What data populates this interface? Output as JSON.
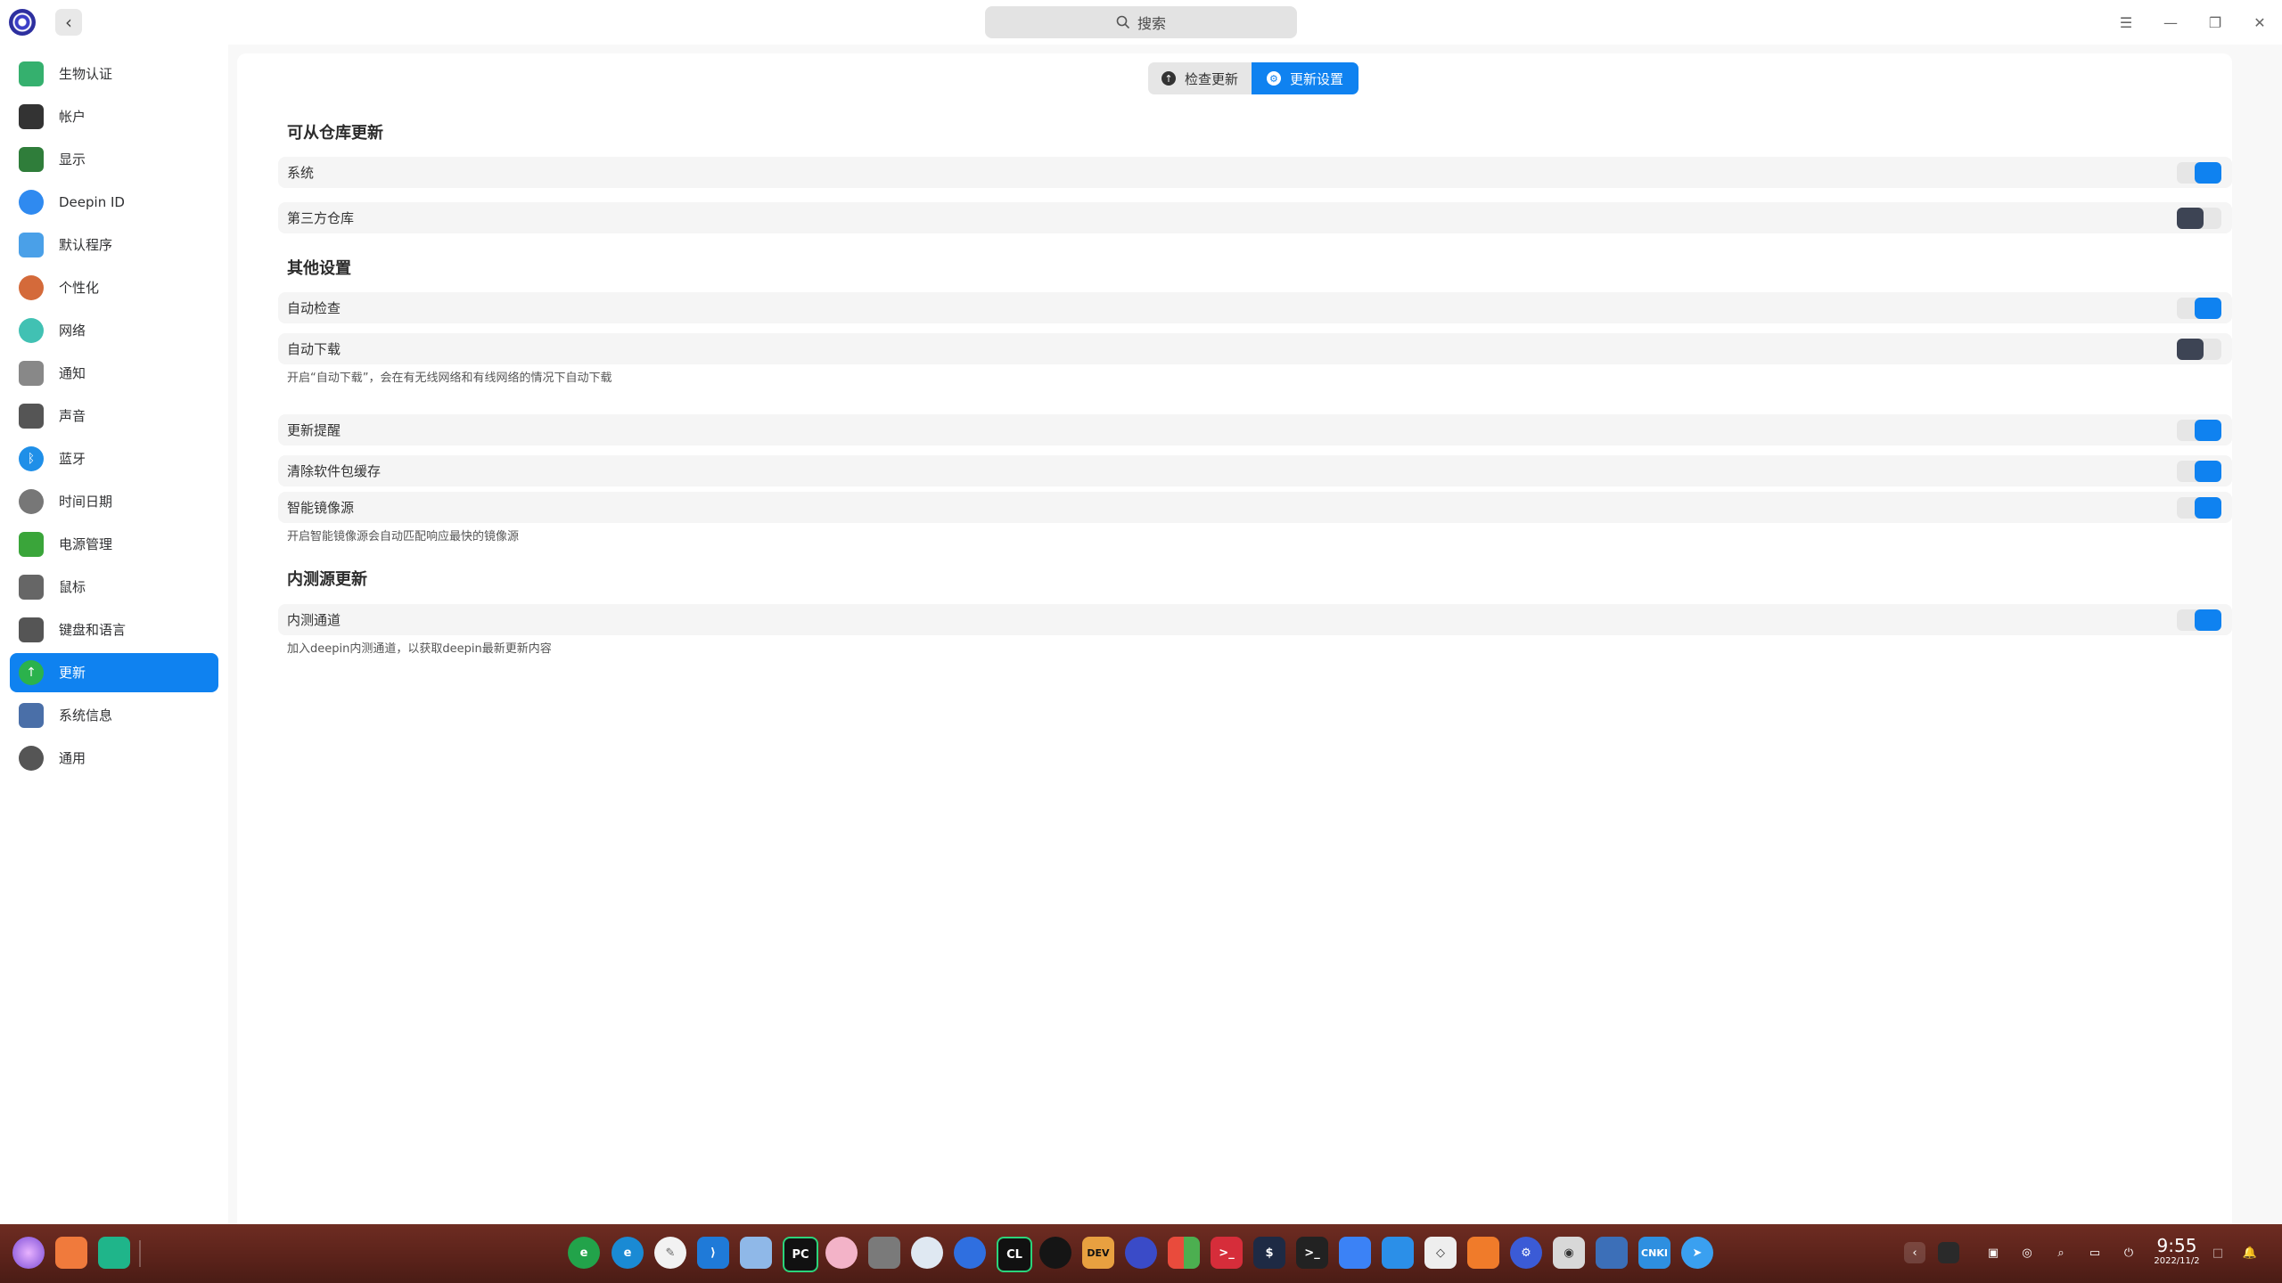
{
  "search": {
    "placeholder": "搜索"
  },
  "window_controls": {
    "menu": "☰",
    "minimize": "—",
    "maximize": "❐",
    "close": "✕"
  },
  "sidebar": {
    "items": [
      {
        "label": "生物认证",
        "icon": "fingerprint-icon",
        "active": false
      },
      {
        "label": "帐户",
        "icon": "account-icon",
        "active": false
      },
      {
        "label": "显示",
        "icon": "display-icon",
        "active": false
      },
      {
        "label": "Deepin ID",
        "icon": "cloud-icon",
        "active": false
      },
      {
        "label": "默认程序",
        "icon": "default-apps-icon",
        "active": false
      },
      {
        "label": "个性化",
        "icon": "personalization-icon",
        "active": false
      },
      {
        "label": "网络",
        "icon": "network-icon",
        "active": false
      },
      {
        "label": "通知",
        "icon": "bell-icon",
        "active": false
      },
      {
        "label": "声音",
        "icon": "speaker-icon",
        "active": false
      },
      {
        "label": "蓝牙",
        "icon": "bluetooth-icon",
        "active": false
      },
      {
        "label": "时间日期",
        "icon": "clock-icon",
        "active": false
      },
      {
        "label": "电源管理",
        "icon": "battery-icon",
        "active": false
      },
      {
        "label": "鼠标",
        "icon": "mouse-icon",
        "active": false
      },
      {
        "label": "键盘和语言",
        "icon": "keyboard-icon",
        "active": false
      },
      {
        "label": "更新",
        "icon": "update-arrow-icon",
        "active": true
      },
      {
        "label": "系统信息",
        "icon": "system-info-icon",
        "active": false
      },
      {
        "label": "通用",
        "icon": "general-icon",
        "active": false
      }
    ]
  },
  "tabs": {
    "check_update": "检查更新",
    "update_settings": "更新设置",
    "active": "update_settings"
  },
  "sections": {
    "repo_title": "可从仓库更新",
    "other_title": "其他设置",
    "internal_title": "内测源更新"
  },
  "settings": {
    "system": {
      "label": "系统",
      "on": true
    },
    "third_party": {
      "label": "第三方仓库",
      "on": false
    },
    "auto_check": {
      "label": "自动检查",
      "on": true
    },
    "auto_download": {
      "label": "自动下载",
      "on": false
    },
    "auto_download_hint": "开启“自动下载”，会在有无线网络和有线网络的情况下自动下载",
    "update_reminder": {
      "label": "更新提醒",
      "on": true
    },
    "clear_cache": {
      "label": "清除软件包缓存",
      "on": true
    },
    "smart_mirror": {
      "label": "智能镜像源",
      "on": true
    },
    "smart_mirror_hint": "开启智能镜像源会自动匹配响应最快的镜像源",
    "internal_channel": {
      "label": "内测通道",
      "on": true
    },
    "internal_channel_hint": "加入deepin内测通道，以获取deepin最新更新内容"
  },
  "taskbar": {
    "clock_time": "9:55",
    "clock_date": "2022/11/2",
    "dock_labels": {
      "pycharm": "PC",
      "clion": "CL",
      "devtools": "DEV",
      "cnki": "CNKI"
    },
    "colors": {
      "accent": "#0f82f0"
    }
  }
}
